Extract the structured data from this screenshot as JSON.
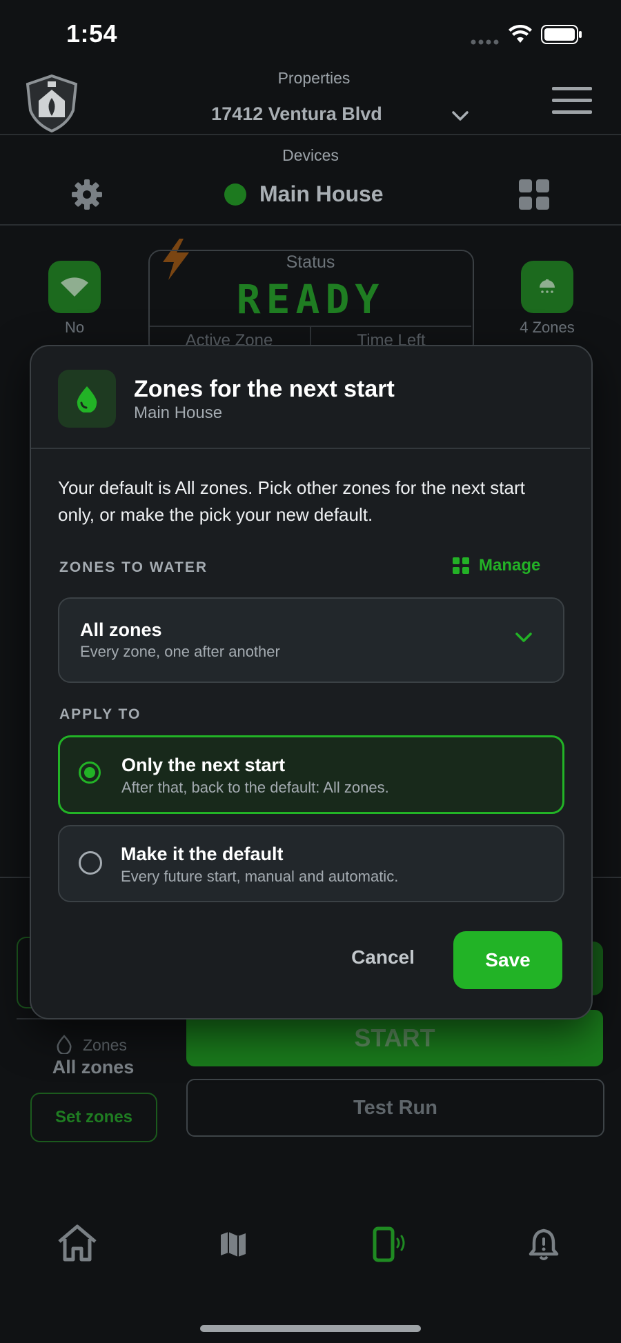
{
  "status_bar": {
    "time": "1:54"
  },
  "header": {
    "properties_label": "Properties",
    "property_value": "17412 Ventura Blvd",
    "devices_label": "Devices",
    "device_name": "Main House",
    "device_status_color": "#1d7a1f"
  },
  "dashboard": {
    "wifi_label": "No",
    "zones_count_label": "4 Zones",
    "status_title": "Status",
    "status_value": "READY",
    "active_zone_label": "Active Zone",
    "time_left_label": "Time Left",
    "zones_small_label": "Zones",
    "zones_value": "All zones",
    "set_zones_label": "Set zones",
    "start_label": "START",
    "test_run_label": "Test Run"
  },
  "modal": {
    "title": "Zones for the next start",
    "subtitle": "Main House",
    "description": "Your default is All zones. Pick other zones for the next start only, or make the pick your new default.",
    "zones_section_label": "ZONES TO WATER",
    "manage_label": "Manage",
    "select": {
      "title": "All zones",
      "subtitle": "Every zone, one after another"
    },
    "apply_section_label": "APPLY TO",
    "options": [
      {
        "title": "Only the next start",
        "subtitle": "After that, back to the default: All zones.",
        "selected": true
      },
      {
        "title": "Make it the default",
        "subtitle": "Every future start, manual and automatic.",
        "selected": false
      }
    ],
    "cancel_label": "Cancel",
    "save_label": "Save"
  },
  "theme": {
    "accent": "#22b326",
    "background": "#101214",
    "modal_bg": "#1a1d20"
  },
  "bottom_nav": {
    "items": [
      "home-icon",
      "map-icon",
      "device-icon",
      "alert-bell-icon"
    ],
    "active_index": 2
  }
}
